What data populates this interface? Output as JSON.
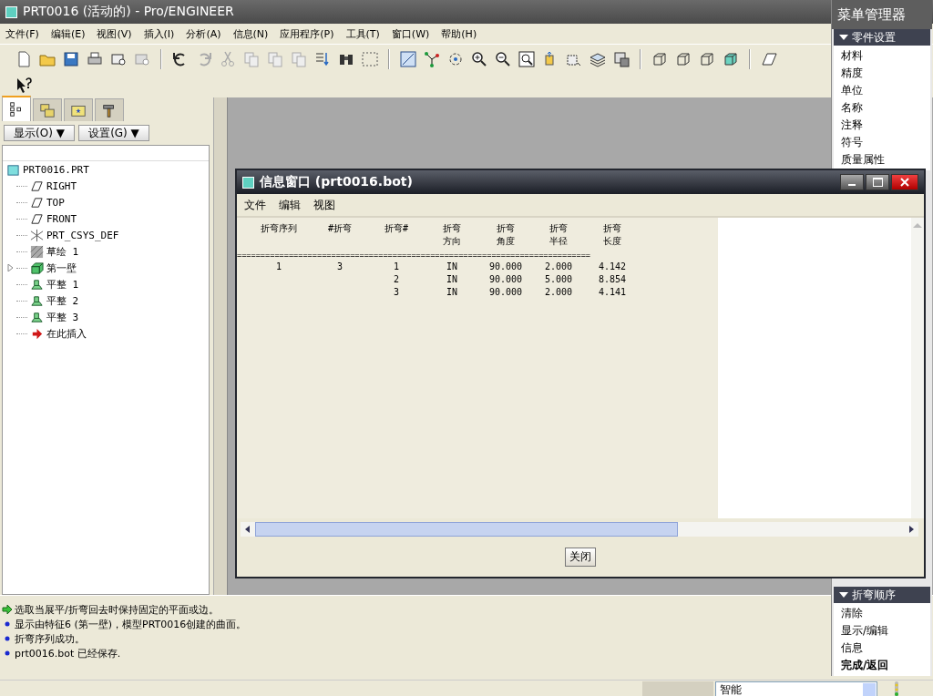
{
  "window": {
    "title": "PRT0016 (活动的) - Pro/ENGINEER"
  },
  "menu_bar": [
    "文件(F)",
    "编辑(E)",
    "视图(V)",
    "插入(I)",
    "分析(A)",
    "信息(N)",
    "应用程序(P)",
    "工具(T)",
    "窗口(W)",
    "帮助(H)"
  ],
  "model_tree": {
    "tabs": [
      {
        "kind": "tree",
        "selected": true
      },
      {
        "kind": "folders",
        "selected": false
      },
      {
        "kind": "favorites",
        "selected": false
      },
      {
        "kind": "tools",
        "selected": false
      }
    ],
    "buttons": [
      "显示(O) ▼",
      "设置(G) ▼"
    ],
    "root": {
      "label": "PRT0016.PRT",
      "kind": "part",
      "children": [
        {
          "label": "RIGHT",
          "kind": "plane"
        },
        {
          "label": "TOP",
          "kind": "plane"
        },
        {
          "label": "FRONT",
          "kind": "plane"
        },
        {
          "label": "PRT_CSYS_DEF",
          "kind": "csys"
        },
        {
          "label": "草绘 1",
          "kind": "sketch"
        },
        {
          "label": "第一壁",
          "kind": "wall",
          "expanded": false
        },
        {
          "label": "平整 1",
          "kind": "flat"
        },
        {
          "label": "平整 2",
          "kind": "flat"
        },
        {
          "label": "平整 3",
          "kind": "flat"
        },
        {
          "label": "在此插入",
          "kind": "insert"
        }
      ]
    }
  },
  "info_window": {
    "title": "信息窗口 (prt0016.bot)",
    "menu": [
      "文件",
      "编辑",
      "视图"
    ],
    "columns": [
      {
        "lines": [
          "折弯序列"
        ]
      },
      {
        "lines": [
          "#折弯"
        ]
      },
      {
        "lines": [
          "折弯#"
        ]
      },
      {
        "lines": [
          "折弯",
          "方向"
        ]
      },
      {
        "lines": [
          "折弯",
          "角度"
        ]
      },
      {
        "lines": [
          "折弯",
          "半径"
        ]
      },
      {
        "lines": [
          "折弯",
          "长度"
        ]
      }
    ],
    "separator": "===========================================================================",
    "rows": [
      {
        "sequence": "1",
        "count": "3",
        "bend": "1",
        "direction": "IN",
        "angle": "90.000",
        "radius": "2.000",
        "length": "4.142"
      },
      {
        "bend": "2",
        "direction": "IN",
        "angle": "90.000",
        "radius": "5.000",
        "length": "8.854"
      },
      {
        "bend": "3",
        "direction": "IN",
        "angle": "90.000",
        "radius": "2.000",
        "length": "4.141"
      }
    ],
    "close_button": "关闭"
  },
  "menu_manager": {
    "title": "菜单管理器",
    "sections": [
      {
        "title": "零件设置",
        "items": [
          {
            "label": "材料",
            "default": false
          },
          {
            "label": "精度",
            "default": false
          },
          {
            "label": "单位",
            "default": false
          },
          {
            "label": "名称",
            "default": false
          },
          {
            "label": "注释",
            "default": false
          },
          {
            "label": "符号",
            "default": false
          },
          {
            "label": "质量属性",
            "default": false
          }
        ]
      },
      {
        "title": "折弯顺序",
        "items": [
          {
            "label": "清除",
            "default": false
          },
          {
            "label": "显示/编辑",
            "default": false
          },
          {
            "label": "信息",
            "default": false
          },
          {
            "label": "完成/返回",
            "default": true
          }
        ]
      }
    ]
  },
  "messages": [
    {
      "kind": "prompt",
      "text": "选取当展平/折弯回去时保持固定的平面或边。"
    },
    {
      "kind": "info",
      "text": "显示由特征6 (第一壁)，模型PRT0016创建的曲面。"
    },
    {
      "kind": "info",
      "text": "折弯序列成功。"
    },
    {
      "kind": "info",
      "text": "prt0016.bot 已经保存."
    }
  ],
  "status_bar": {
    "filter": "智能"
  }
}
